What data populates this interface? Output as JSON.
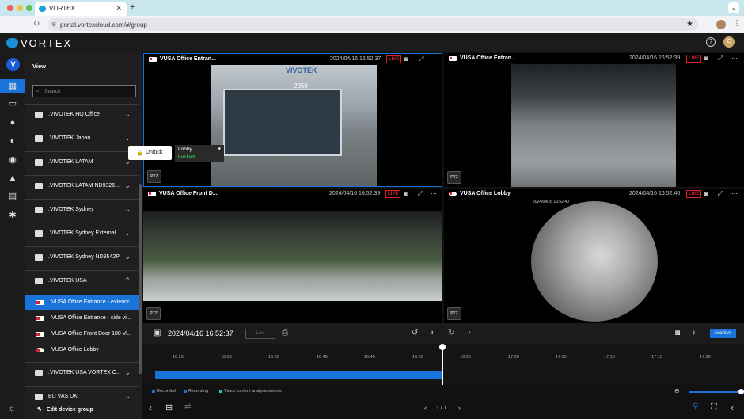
{
  "browser": {
    "tab_title": "VORTEX",
    "url": "portal.vortexcloud.com/#/group",
    "profile_initial": "C"
  },
  "app": {
    "brand": "VORTEX",
    "user_initial": "V",
    "avatar_initial": "C",
    "help": "?"
  },
  "sidebar": {
    "title": "View",
    "search_placeholder": "Search",
    "groups": [
      ".VIVOTEK HQ Office",
      ".VIVOTEK Japan",
      ".VIVOTEK LATAM",
      ".VIVOTEK LATAM ND9326...",
      ".VIVOTEK Sydney",
      ".VIVOTEK Sydney External",
      ".VIVOTEK Sydney ND9542P",
      ".VIVOTEK USA"
    ],
    "devices": [
      "VUSA Office Entrance - exterior",
      "VUSA Office Entrance - side vi...",
      "VUSA Office Front Door 180 Vi...",
      "VUSA Office Lobby"
    ],
    "groups_after": [
      ".VIVOTEK USA VORTEX C...",
      "EU VAS UK"
    ],
    "edit_label": "Edit device group"
  },
  "cameras": [
    {
      "title": "VUSA Office Entran...",
      "timestamp": "2024/04/16 16:52:37",
      "live": "LIVE"
    },
    {
      "title": "VUSA Office Entran...",
      "timestamp": "2024/04/16 16:52:39",
      "live": "LIVE"
    },
    {
      "title": "VUSA Office Front D...",
      "timestamp": "2024/04/16 16:52:39",
      "live": "LIVE"
    },
    {
      "title": "VUSA Office Lobby",
      "timestamp": "2024/04/16 16:52:40",
      "live": "LIVE"
    }
  ],
  "overlay": {
    "fisheye_stamp": "2024/04/16 16:52:40",
    "sign_brand": "VIVOTEK",
    "sign_number": "2050",
    "ptz_label": "PTZ"
  },
  "door": {
    "unlock_label": "Unlock",
    "door_name": "Lobby",
    "status": "Locked"
  },
  "playback": {
    "datetime": "2024/04/16 16:52:37",
    "live_label": "Live",
    "archive_label": "Archive",
    "ticks": [
      "16:25",
      "16:30",
      "16:35",
      "16:40",
      "16:45",
      "16:50",
      "16:55",
      "17:00",
      "17:05",
      "17:10",
      "17:15",
      "17:20"
    ],
    "legend": [
      "Recorded",
      "Recording",
      "Video content analysis events"
    ],
    "legend_colors": [
      "#1a73d9",
      "#1a73d9",
      "#27c4c4"
    ],
    "page": "1 / 1"
  }
}
